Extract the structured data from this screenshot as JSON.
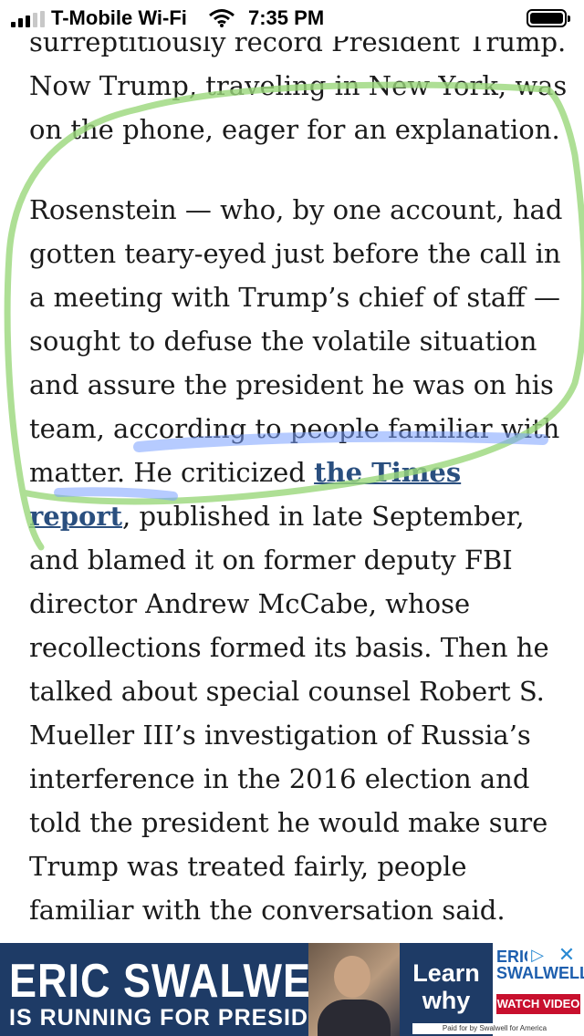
{
  "status_bar": {
    "carrier": "T-Mobile Wi-Fi",
    "time": "7:35 PM"
  },
  "article": {
    "para1_cutoff": "surreptitiously record President Trump.",
    "para1_rest": "Now Trump, traveling in New York, was on the phone, eager for an explanation.",
    "para2_before_link": "Rosenstein — who, by one account, had gotten teary-eyed just before the call in a meeting with Trump’s chief of staff — sought to defuse the volatile situation and assure the president he was on his team, according to people familiar with matter. He criticized ",
    "para2_link": "the Times report",
    "para2_after_link": ", published in late September, and blamed it on former deputy FBI director Andrew McCabe, whose recollections formed its basis. Then he talked about special counsel Robert S. Mueller III’s investigation of Russia’s interference in the 2016 election and told the president he would make sure Trump was treated fairly, people familiar with the conversation said."
  },
  "ad": {
    "headline": "ERIC SWALWELL",
    "subheadline": "IS RUNNING FOR PRESIDENT",
    "learn_why": "Learn why",
    "logo_text": "ERIC SWALWELL",
    "watch_video": "WATCH VIDEO",
    "paid_for": "Paid for by Swalwell for America",
    "colors": {
      "background": "#1e3b66",
      "watch_button": "#c8102e",
      "link": "#2a4f7f"
    }
  },
  "annotations": {
    "green_loop_color": "#9ad77a",
    "blue_underline_color": "#7aa0ff"
  }
}
